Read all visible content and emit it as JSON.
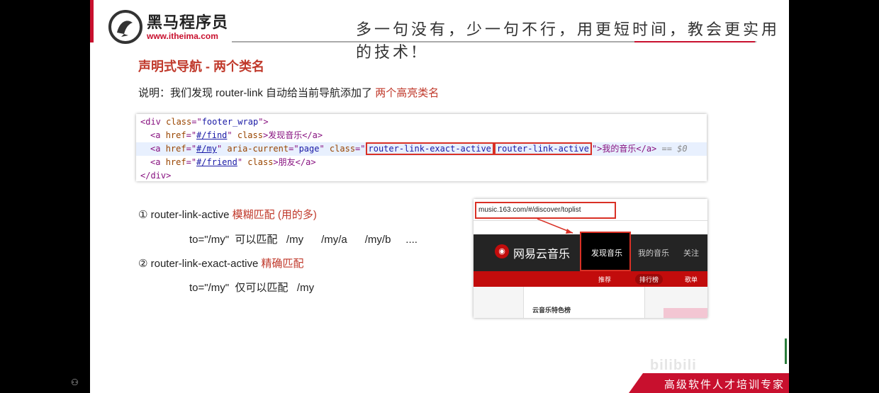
{
  "header": {
    "brand": "黑马程序员",
    "brand_url": "www.itheima.com",
    "slogan": "多一句没有，少一句不行，用更短时间，教会更实用的技术!"
  },
  "main": {
    "heading": "声明式导航 - 两个类名",
    "desc_prefix": "说明：我们发现 router-link 自动给当前导航添加了 ",
    "desc_highlight": "两个高亮类名"
  },
  "code": {
    "l1_open": "<div ",
    "l1_attr": "class",
    "l1_eq": "=\"",
    "l1_val": "footer_wrap",
    "l1_close": "\">",
    "l2_open": "<a ",
    "l2_attr": "href",
    "l2_eq": "=\"",
    "l2_link": "#/find",
    "l2_mid": "\" ",
    "l2_attr2": "class",
    "l2_text": ">发现音乐</a>",
    "l3_open": "<a ",
    "l3_attr": "href",
    "l3_eq": "=\"",
    "l3_link": "#/my",
    "l3_mid": "\" ",
    "l3_attr2": "aria-current",
    "l3_eq2": "=\"",
    "l3_val2": "page",
    "l3_mid2": "\" ",
    "l3_attr3": "class",
    "l3_eq3": "=\"",
    "l3_class1": "router-link-exact-active",
    "l3_class2": "router-link-active",
    "l3_end": "\">我的音乐</a>",
    "l3_suffix": " == $0",
    "l4_open": "<a ",
    "l4_attr": "href",
    "l4_eq": "=\"",
    "l4_link": "#/friend",
    "l4_mid": "\" ",
    "l4_attr2": "class",
    "l4_text": ">朋友</a>",
    "l5": "</div>"
  },
  "points": {
    "p1_label": "① router-link-active ",
    "p1_highlight": "模糊匹配 (用的多)",
    "p1_sub": "to=\"/my\"  可以匹配   /my      /my/a      /my/b     ....",
    "p2_label": "② router-link-exact-active ",
    "p2_highlight": "精确匹配",
    "p2_sub": "to=\"/my\"  仅可以匹配   /my"
  },
  "screenshot": {
    "url": "music.163.com/#/discover/toplist",
    "site_title": "网易云音乐",
    "nav_active": "发现音乐",
    "nav_mine": "我的音乐",
    "nav_follow": "关注",
    "sub_recommend": "推荐",
    "sub_rank": "排行榜",
    "sub_playlist": "歌单",
    "content_title": "云音乐特色榜"
  },
  "footer": {
    "tagline": "高级软件人才培训专家"
  },
  "colors": {
    "accent_red": "#c8102e",
    "heading_red": "#c0392b"
  }
}
